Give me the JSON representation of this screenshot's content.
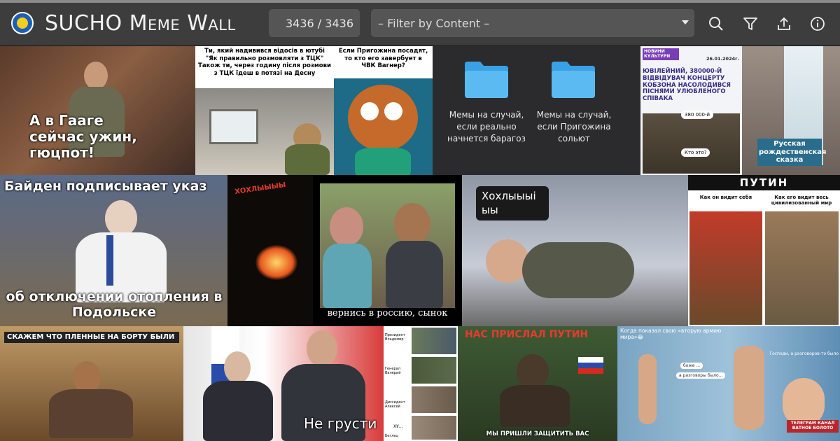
{
  "app": {
    "title": "SUCHO Meme Wall",
    "counter": "3436 / 3436"
  },
  "filter": {
    "placeholder": "– Filter by Content –"
  },
  "toolbar_icons": [
    "search-icon",
    "filter-icon",
    "upload-icon",
    "info-icon"
  ],
  "colors": {
    "topbar": "#3d3d3d",
    "control": "#555555",
    "text": "#f2f2f2",
    "logo_blue": "#1d5fb5",
    "logo_yellow": "#f5cd1f"
  },
  "memes": {
    "hague": {
      "caption": "А в Гааге сейчас ужин, гюцпот!"
    },
    "tck": {
      "text": "Ти, який надивився відосів в ютубі \"Як правильно розмовляти з ТЦК\"  Також ти, через годину після розмови з ТЦК їдеш в потязі на Десну"
    },
    "prigozhin_monkey": {
      "text": "Если Пригожина посадят, то кто его завербует в ЧВК Вагнер?"
    },
    "folders": {
      "folder1": "Мемы на случай, если реально начнется барагоз",
      "folder2": "Мемы на случай, если Пригожина сольют"
    },
    "kobzon": {
      "badge": "НОВИНИ КУЛЬТУРИ",
      "date": "26.01.2024г.",
      "headline": "ЮВІЛЕЙНИЙ, 380000-Й ВІДВІДУВАЧ КОНЦЕРТУ КОБЗОНА НАСОЛОДИВСЯ ПІСНЯМИ УЛЮБЛЕНОГО СПІВАКА",
      "bubble1": "380 000-й",
      "bubble2": "Кто это?"
    },
    "ice_building": {
      "caption": "Русская рождественская сказка"
    },
    "biden": {
      "top": "Байден подписывает указ",
      "bottom": "об отключении отопления в Подольске"
    },
    "fire": {
      "sign": "ХОХЛЫЫЫЫ"
    },
    "mother": {
      "caption": "вернись в россию, сынок"
    },
    "khokhly": {
      "bubble": "Хохлыыыі ыы"
    },
    "putin_napoleon": {
      "title": "ПУТИН",
      "left": "Как он видит себя",
      "right": "Как его видит весь цивилизованный мир"
    },
    "prisoners": {
      "caption": "СКАЖЕМ ЧТО ПЛЕННЫЕ НА БОРТУ БЫЛИ"
    },
    "erdogan": {
      "caption": "Не грусти"
    },
    "mosaic": {
      "l1": "Президент Владимир",
      "l2": "Генерал Валерий",
      "l3": "Диссидент Алексей",
      "l4": "ХУ...",
      "l5": "Беглец"
    },
    "apes": {
      "top": "НАС ПРИСЛАЛ ПУТИН",
      "bottom": "МЫ ПРИШЛИ ЗАЩИТИТЬ ВАС"
    },
    "second_army": {
      "top": "Когда показал свою «вторую армию мира»😂",
      "b1": "боже ...",
      "b2": "а разговоры было...",
      "right": "Господи, а разговоров-то было",
      "badge": "ТЕЛЕГРАМ КАНАЛ ВАТНОЕ БОЛОТО"
    }
  }
}
